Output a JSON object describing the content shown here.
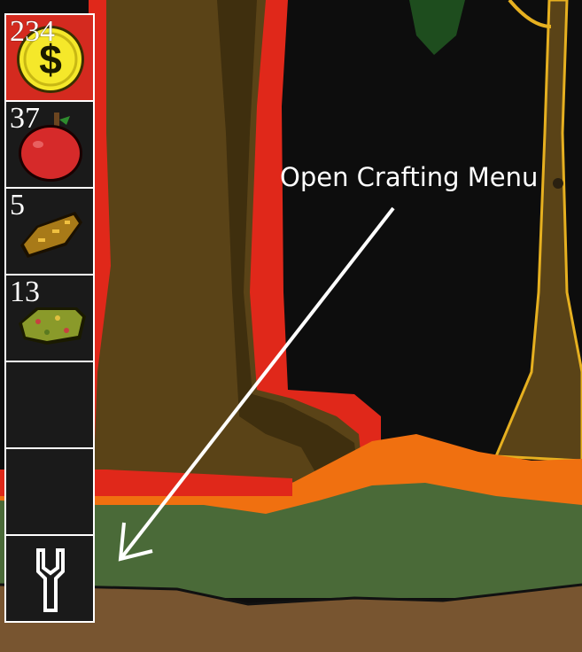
{
  "colors": {
    "sky": "#0d0d0d",
    "trunk": "#5a4317",
    "trunk_shadow": "#3f2f0e",
    "glow_red": "#e0281a",
    "glow_orange": "#f07010",
    "grass": "#4a6a38",
    "dirt": "#785530",
    "slot_bg": "#1a1a1a",
    "slot_selected": "#d42a1f"
  },
  "inventory": {
    "slots": [
      {
        "item": "gold-coin-icon",
        "count": "234",
        "selected": true
      },
      {
        "item": "apple-icon",
        "count": "37",
        "selected": false
      },
      {
        "item": "bread-icon",
        "count": "5",
        "selected": false
      },
      {
        "item": "moss-icon",
        "count": "13",
        "selected": false
      },
      {
        "item": "empty",
        "count": "",
        "selected": false
      },
      {
        "item": "empty",
        "count": "",
        "selected": false
      },
      {
        "item": "wrench-icon",
        "count": "",
        "selected": false
      }
    ]
  },
  "hint": {
    "text": "Open Crafting Menu"
  }
}
